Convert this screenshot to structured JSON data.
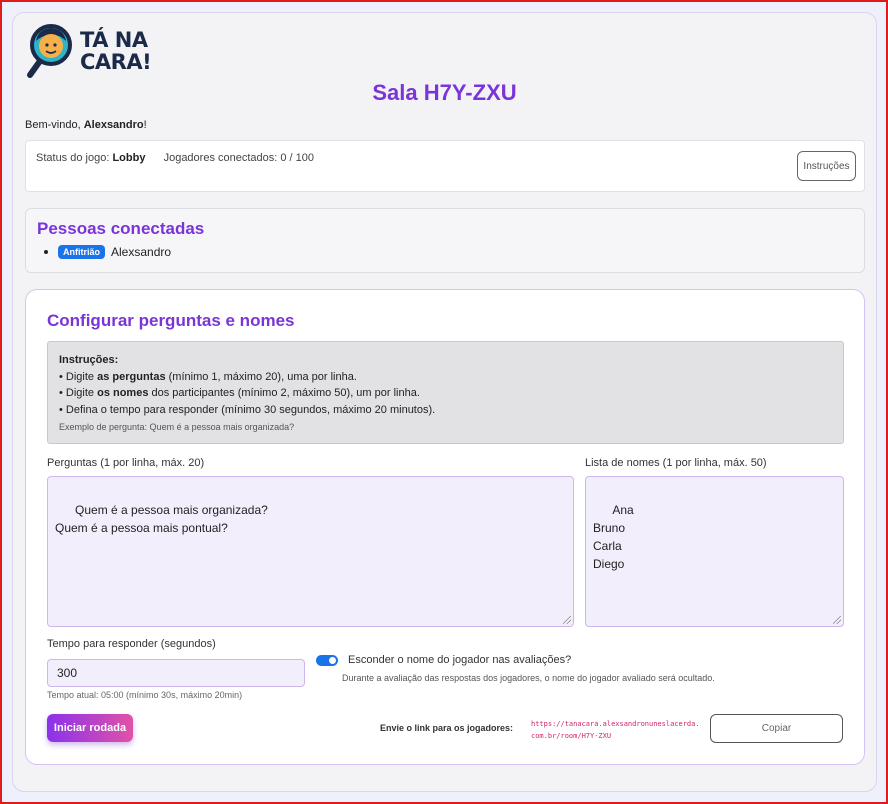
{
  "logo": {
    "line1": "TÁ NA",
    "line2": "CARA!"
  },
  "room": {
    "title": "Sala H7Y-ZXU"
  },
  "welcome": {
    "prefix": "Bem-vindo, ",
    "name": "Alexsandro",
    "suffix": "!"
  },
  "status": {
    "game_label": "Status do jogo:",
    "game_value": "Lobby",
    "players_text": "Jogadores conectados: 0 / 100",
    "instructions_button": "Instruções"
  },
  "people": {
    "title": "Pessoas conectadas",
    "items": [
      {
        "badge": "Anfitrião",
        "name": "Alexsandro"
      }
    ]
  },
  "config": {
    "title": "Configurar perguntas e nomes",
    "instructions": {
      "heading": "Instruções:",
      "line1_pre": "• Digite ",
      "line1_bold": "as perguntas",
      "line1_post": " (mínimo 1, máximo 20), uma por linha.",
      "line2_pre": "• Digite ",
      "line2_bold": "os nomes",
      "line2_post": " dos participantes (mínimo 2, máximo 50), um por linha.",
      "line3": "• Defina o tempo para responder (mínimo 30 segundos, máximo 20 minutos).",
      "example": "Exemplo de pergunta: Quem é a pessoa mais organizada?"
    },
    "questions_label": "Perguntas (1 por linha, máx. 20)",
    "questions_value": "Quem é a pessoa mais organizada?\nQuem é a pessoa mais pontual?",
    "names_label": "Lista de nomes (1 por linha, máx. 50)",
    "names_value": "Ana\nBruno\nCarla\nDiego",
    "time_label": "Tempo para responder (segundos)",
    "time_value": "300",
    "time_hint": "Tempo atual: 05:00 (mínimo 30s, máximo 20min)",
    "hide_name_label": "Esconder o nome do jogador nas avaliações?",
    "hide_name_enabled": true,
    "hide_name_desc": "Durante a avaliação das respostas dos jogadores, o nome do jogador avaliado será ocultado.",
    "start_button": "Iniciar rodada",
    "link_label": "Envie o link para os jogadores:",
    "link_url": "https://tanacara.alexsandronuneslacerda.com.br/room/H7Y-ZXU",
    "copy_button": "Copiar"
  },
  "colors": {
    "accent": "#7a35d8",
    "badge": "#1a73e8",
    "link": "#d0246e"
  }
}
